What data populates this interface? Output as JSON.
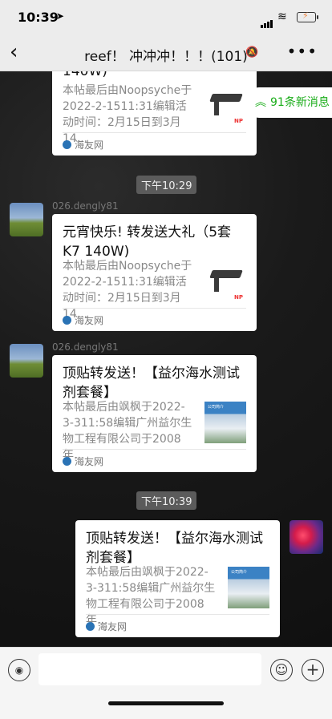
{
  "status": {
    "time": "10:39"
  },
  "header": {
    "title": "reef！ 冲冲冲！！！(101)"
  },
  "new_messages": "91条新消息",
  "messages": [
    {
      "title": "140W)",
      "body": "本帖最后由Noopsyche于2022-2-1511:31编辑活动时间：2月15日到3月14...",
      "source": "海友网",
      "thumb_logo": "NP"
    },
    {
      "sender": "026.dengly81",
      "title": "元宵快乐! 转发送大礼（5套K7 140W)",
      "body": "本帖最后由Noopsyche于2022-2-1511:31编辑活动时间：2月15日到3月14...",
      "source": "海友网",
      "thumb_logo": "NP"
    },
    {
      "sender": "026.dengly81",
      "title": "顶贴转发送！【益尔海水测试剂套餐】",
      "body": "本帖最后由飒枫于2022-3-311:58编辑广州益尔生物工程有限公司于2008年...",
      "source": "海友网",
      "thumb_text": "公司简介"
    },
    {
      "title": "顶贴转发送！【益尔海水测试剂套餐】",
      "body": "本帖最后由飒枫于2022-3-311:58编辑广州益尔生物工程有限公司于2008年...",
      "source": "海友网",
      "thumb_text": "公司简介"
    }
  ],
  "timestamps": [
    "下午10:29",
    "下午10:39"
  ]
}
